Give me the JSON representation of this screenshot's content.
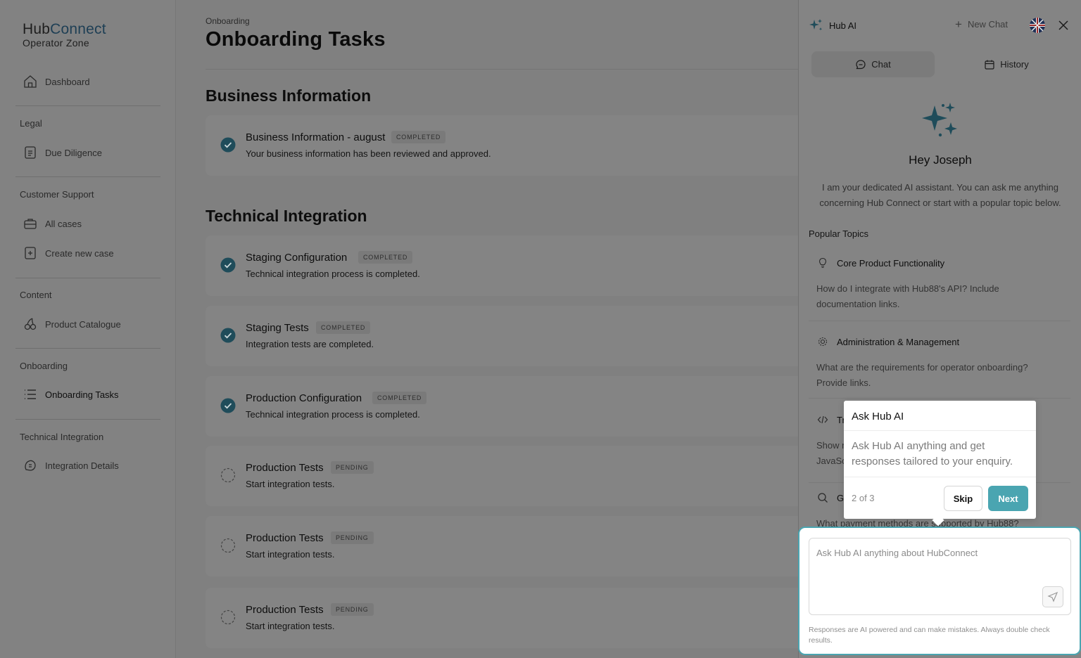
{
  "sidebar": {
    "logo": {
      "part1": "Hub",
      "part2": "Connect",
      "subtitle": "Operator Zone"
    },
    "dashboard": "Dashboard",
    "sections": [
      {
        "title": "Legal",
        "items": [
          "Due Diligence"
        ]
      },
      {
        "title": "Customer Support",
        "items": [
          "All cases",
          "Create new case"
        ]
      },
      {
        "title": "Content",
        "items": [
          "Product Catalogue"
        ]
      },
      {
        "title": "Onboarding",
        "items": [
          "Onboarding Tasks"
        ]
      },
      {
        "title": "Technical Integration",
        "items": [
          "Integration Details"
        ]
      }
    ]
  },
  "main": {
    "breadcrumb": "Onboarding",
    "title": "Onboarding Tasks",
    "business_section": "Business Information",
    "technical_section": "Technical Integration",
    "tasks": [
      {
        "title": "Business Information - august",
        "badge": "COMPLETED",
        "desc": "Your business information has been reviewed and approved.",
        "status": "completed"
      },
      {
        "title": "Staging Configuration",
        "badge": "COMPLETED",
        "desc": "Technical integration process is completed.",
        "status": "completed"
      },
      {
        "title": "Staging Tests",
        "badge": "COMPLETED",
        "desc": "Integration tests are completed.",
        "status": "completed"
      },
      {
        "title": "Production Configuration",
        "badge": "COMPLETED",
        "desc": "Technical integration process is completed.",
        "status": "completed"
      },
      {
        "title": "Production Tests",
        "badge": "PENDING",
        "desc": "Start integration tests.",
        "status": "pending"
      },
      {
        "title": "Production Tests",
        "badge": "PENDING",
        "desc": "Start integration tests.",
        "status": "pending"
      },
      {
        "title": "Production Tests",
        "badge": "PENDING",
        "desc": "Start integration tests.",
        "status": "pending"
      }
    ]
  },
  "panel": {
    "title": "Hub AI",
    "new_chat": "New Chat",
    "tabs": {
      "chat": "Chat",
      "history": "History"
    },
    "greeting": "Hey Joseph",
    "intro": "I am your dedicated AI assistant. You can ask me anything concerning Hub Connect or start with a popular topic below.",
    "popular_topics": "Popular Topics",
    "topics": [
      {
        "title": "Core Product Functionality",
        "question": "How do I integrate with Hub88's API? Include documentation links.",
        "icon": "lightbulb-icon"
      },
      {
        "title": "Administration & Management",
        "question": "What are the requirements for operator onboarding? Provide links.",
        "icon": "gear-icon"
      },
      {
        "title": "Tr",
        "question": "Show me JavaSc",
        "icon": "code-icon"
      },
      {
        "title": "G",
        "question": "What payment methods are supported by Hub88?",
        "icon": "search-icon"
      }
    ],
    "composer": {
      "placeholder": "Ask Hub AI anything about HubConnect",
      "disclaimer": "Responses are AI powered and can make mistakes. Always double check results."
    }
  },
  "tour": {
    "title": "Ask Hub AI",
    "body": "Ask Hub AI anything and get responses tailored to your enquiry.",
    "step": "2 of 3",
    "skip": "Skip",
    "next": "Next"
  },
  "colors": {
    "accent": "#4aa5b1",
    "brand_dark": "#1e3f55",
    "overlay": "#808080"
  }
}
